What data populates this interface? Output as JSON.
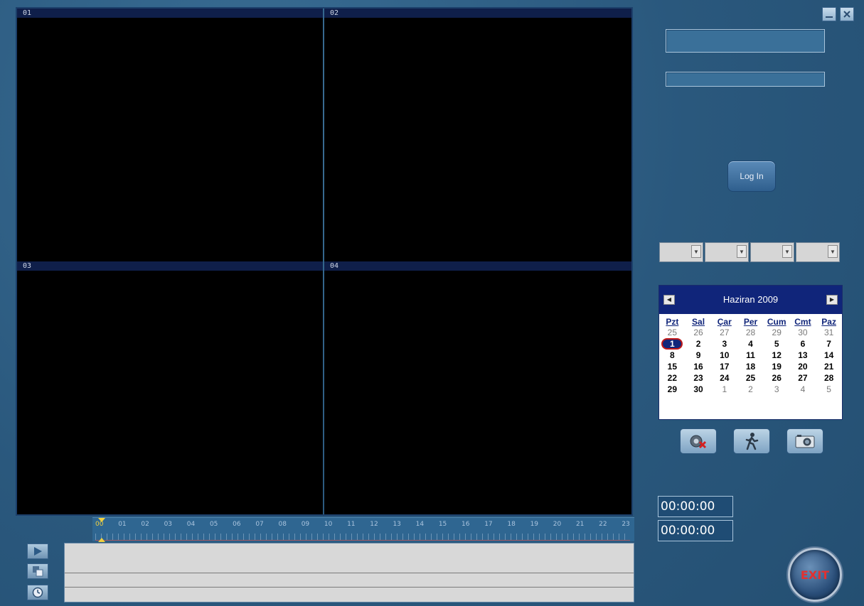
{
  "window": {
    "minimize_icon": "minimize-icon",
    "close_icon": "close-icon"
  },
  "panels": [
    {
      "label": "01"
    },
    {
      "label": "02"
    },
    {
      "label": "03"
    },
    {
      "label": "04"
    }
  ],
  "timeline": {
    "hours": [
      "00",
      "01",
      "02",
      "03",
      "04",
      "05",
      "06",
      "07",
      "08",
      "09",
      "10",
      "11",
      "12",
      "13",
      "14",
      "15",
      "16",
      "17",
      "18",
      "19",
      "20",
      "21",
      "22",
      "23"
    ]
  },
  "login": {
    "user_value": "",
    "password_value": "",
    "login_label": "Log In"
  },
  "calendar": {
    "title": "Haziran 2009",
    "weekdays": [
      "Pzt",
      "Sal",
      "Çar",
      "Per",
      "Cum",
      "Cmt",
      "Paz"
    ],
    "weeks": [
      [
        "25",
        "26",
        "27",
        "28",
        "29",
        "30",
        "31"
      ],
      [
        "1",
        "2",
        "3",
        "4",
        "5",
        "6",
        "7"
      ],
      [
        "8",
        "9",
        "10",
        "11",
        "12",
        "13",
        "14"
      ],
      [
        "15",
        "16",
        "17",
        "18",
        "19",
        "20",
        "21"
      ],
      [
        "22",
        "23",
        "24",
        "25",
        "26",
        "27",
        "28"
      ],
      [
        "29",
        "30",
        "1",
        "2",
        "3",
        "4",
        "5"
      ]
    ],
    "selected": "1"
  },
  "times": {
    "start": "00:00:00",
    "end": "00:00:00"
  },
  "exit_label": "EXIT",
  "colors": {
    "background": "#2d5d82",
    "calendar_header": "#10257a",
    "exit_text": "#e23030"
  }
}
